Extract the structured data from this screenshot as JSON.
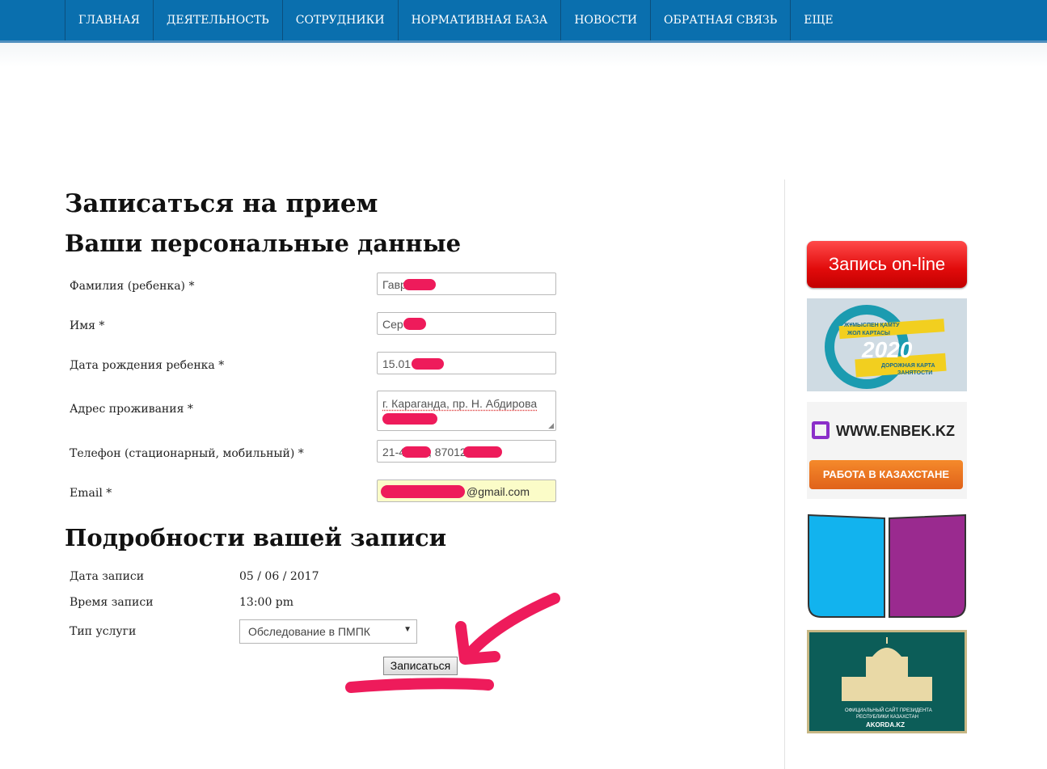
{
  "nav": {
    "items": [
      {
        "label": "ГЛАВНАЯ"
      },
      {
        "label": "ДЕЯТЕЛЬНОСТЬ"
      },
      {
        "label": "СОТРУДНИКИ"
      },
      {
        "label": "НОРМАТИВНАЯ БАЗА"
      },
      {
        "label": "НОВОСТИ"
      },
      {
        "label": "ОБРАТНАЯ СВЯЗЬ"
      },
      {
        "label": "ЕЩЕ"
      }
    ]
  },
  "page": {
    "title": "Записаться на прием",
    "personal_heading": "Ваши персональные данные",
    "details_heading": "Подробности вашей записи"
  },
  "form": {
    "surname": {
      "label": "Фамилия (ребенка) *",
      "value": "Гавр"
    },
    "name": {
      "label": "Имя *",
      "value": "Сер"
    },
    "birthdate": {
      "label": "Дата рождения ребенка *",
      "value": "15.01"
    },
    "address": {
      "label": "Адрес проживания *",
      "value": "г. Караганда, пр. Н. Абдирова"
    },
    "phone": {
      "label": "Телефон (стационарный, мобильный) *",
      "value_a": "21-4",
      "value_b": ", 87012"
    },
    "email": {
      "label": "Email *",
      "value": "@gmail.com"
    }
  },
  "details": {
    "date": {
      "label": "Дата записи",
      "value": "05 / 06 / 2017"
    },
    "time": {
      "label": "Время записи",
      "value": "13:00 pm"
    },
    "service": {
      "label": "Тип услуги",
      "selected": "Обследование в ПМПК"
    },
    "submit_label": "Записаться"
  },
  "sidebar": {
    "online_label": "Запись on-line",
    "roadmap": {
      "line1": "ЖҰМЫСПЕН ҚАМТУ",
      "line2": "ЖОЛ КАРТАСЫ",
      "year": "2020",
      "line3": "ДОРОЖНАЯ КАРТА",
      "line4": "ЗАНЯТОСТИ"
    },
    "enbek": {
      "site": "WWW.ENBEK.KZ",
      "button": "РАБОТА В КАЗАХСТАНЕ"
    },
    "akorda": {
      "line1": "ОФИЦИАЛЬНЫЙ САЙТ ПРЕЗИДЕНТА",
      "line2": "РЕСПУБЛИКИ КАЗАХСТАН",
      "line3": "AKORDA.KZ"
    }
  },
  "colors": {
    "nav_bg": "#0a6fae",
    "redaction": "#ee1b5b",
    "online_button": "#e10b0b"
  }
}
